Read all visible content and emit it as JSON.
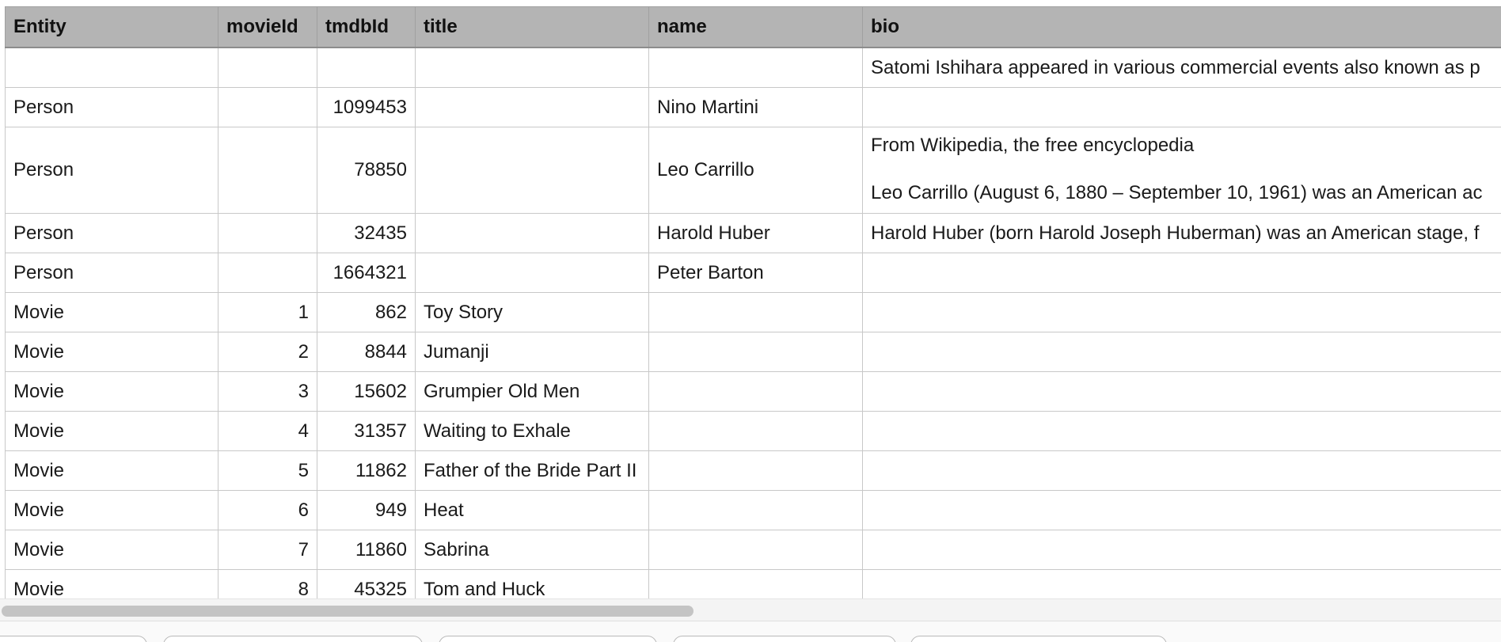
{
  "columns": [
    "Entity",
    "movieId",
    "tmdbId",
    "title",
    "name",
    "bio"
  ],
  "rows": [
    {
      "entity": "",
      "movieId": "",
      "tmdbId": "",
      "title": "",
      "name": "",
      "bio": "Satomi Ishihara appeared in various commercial events also known as p"
    },
    {
      "entity": "Person",
      "movieId": "",
      "tmdbId": "1099453",
      "title": "",
      "name": "Nino Martini",
      "bio": ""
    },
    {
      "entity": "Person",
      "movieId": "",
      "tmdbId": "78850",
      "title": "",
      "name": "Leo Carrillo",
      "bio_line1": "From Wikipedia, the free encyclopedia",
      "bio_line2": "Leo Carrillo (August 6, 1880 – September 10, 1961) was an American ac"
    },
    {
      "entity": "Person",
      "movieId": "",
      "tmdbId": "32435",
      "title": "",
      "name": "Harold Huber",
      "bio": "Harold Huber (born Harold Joseph Huberman) was an American stage, f"
    },
    {
      "entity": "Person",
      "movieId": "",
      "tmdbId": "1664321",
      "title": "",
      "name": "Peter Barton",
      "bio": ""
    },
    {
      "entity": "Movie",
      "movieId": "1",
      "tmdbId": "862",
      "title": "Toy Story",
      "name": "",
      "bio": ""
    },
    {
      "entity": "Movie",
      "movieId": "2",
      "tmdbId": "8844",
      "title": "Jumanji",
      "name": "",
      "bio": ""
    },
    {
      "entity": "Movie",
      "movieId": "3",
      "tmdbId": "15602",
      "title": "Grumpier Old Men",
      "name": "",
      "bio": ""
    },
    {
      "entity": "Movie",
      "movieId": "4",
      "tmdbId": "31357",
      "title": "Waiting to Exhale",
      "name": "",
      "bio": ""
    },
    {
      "entity": "Movie",
      "movieId": "5",
      "tmdbId": "11862",
      "title": "Father of the Bride Part II",
      "name": "",
      "bio": ""
    },
    {
      "entity": "Movie",
      "movieId": "6",
      "tmdbId": "949",
      "title": "Heat",
      "name": "",
      "bio": ""
    },
    {
      "entity": "Movie",
      "movieId": "7",
      "tmdbId": "11860",
      "title": "Sabrina",
      "name": "",
      "bio": ""
    },
    {
      "entity": "Movie",
      "movieId": "8",
      "tmdbId": "45325",
      "title": "Tom and Huck",
      "name": "",
      "bio": ""
    }
  ]
}
